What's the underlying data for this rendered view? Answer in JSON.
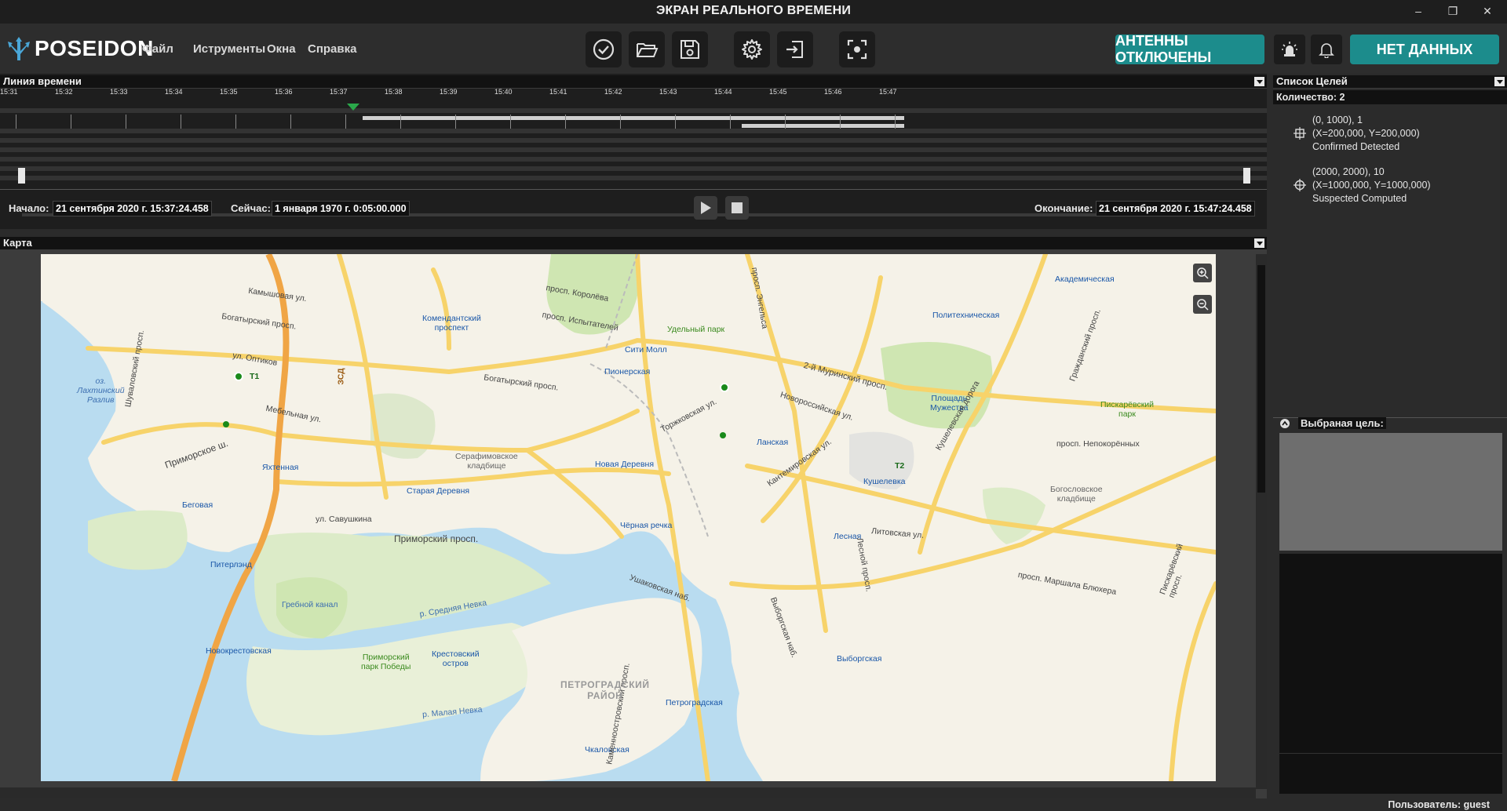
{
  "window": {
    "title": "ЭКРАН РЕАЛЬНОГО ВРЕМЕНИ"
  },
  "app": {
    "logo_text": "POSEIDON",
    "menu": [
      "Файл",
      "Иструменты",
      "Окна",
      "Справка"
    ],
    "antennas_button": "АНТЕННЫ ОТКЛЮЧЕНЫ",
    "data_button": "НЕТ ДАННЫХ",
    "toolbar_icons": [
      "check-circle-icon",
      "folder-open-icon",
      "save-icon",
      "gear-icon",
      "sign-in-icon",
      "focus-icon"
    ],
    "accent_color": "#1c8c8c"
  },
  "timeline": {
    "title": "Линия времени",
    "ticks": [
      "15:31",
      "15:32",
      "15:33",
      "15:34",
      "15:35",
      "15:36",
      "15:37",
      "15:38",
      "15:39",
      "15:40",
      "15:41",
      "15:42",
      "15:43",
      "15:44",
      "15:45",
      "15:46",
      "15:47"
    ],
    "start_label": "Начало:",
    "start_value": "21 сентября 2020 г. 15:37:24.458",
    "now_label": "Сейчас:",
    "now_value": "1 января 1970 г. 0:05:00.000",
    "end_label": "Окончание:",
    "end_value": "21 сентября 2020 г. 15:47:24.458"
  },
  "map": {
    "title": "Карта",
    "district": "ПЕТРОГРАДСКИЙ\nРАЙОН",
    "labels": [
      "Комендантский\nпроспект",
      "Удельный парк",
      "Сити Молл",
      "Пионерская",
      "Политехническая",
      "Академическая",
      "Площадь\nМужества",
      "Пискарёвский\nпарк",
      "Ланская",
      "Новая Деревня",
      "Серафимовское\nкладбище",
      "Старая Деревня",
      "Беговая",
      "Яхтенная",
      "Кушелевка",
      "Богословское\nкладбище",
      "Чёрная речка",
      "Лесная",
      "Выборгская",
      "Питерлэнд",
      "Новокрестовская",
      "Приморский\nпарк Победы",
      "Крестовский\nостров",
      "Петроградская",
      "Чкаловская",
      "оз.\nЛахтинский\nРазлив",
      "Богатырский просп.",
      "Приморский просп.",
      "Приморское ш.",
      "2-й Муринский просп.",
      "просп. Непокорённых",
      "Гребной канал",
      "р. Средняя Невка",
      "р. Малая Невка",
      "Ушаковская наб.",
      "Выборгская наб.",
      "просп. Энгельса",
      "Торжковская ул.",
      "просп. Маршала Блюхера",
      "Кушелевская дорога",
      "Гражданский просп.",
      "Пискарёвский просп.",
      "Лесной просп.",
      "ул. Савушкина",
      "Шуваловский просп.",
      "Камышовая ул.",
      "Богатырский просп.",
      "ул. Оптиков",
      "Мебельная ул.",
      "Каменноостровский просп.",
      "Литовская ул.",
      "просп. Королёва",
      "просп. Испытателей",
      "Новороссийская ул.",
      "Кантемировская ул.",
      "ЗСД",
      "Т1",
      "Т2"
    ]
  },
  "targets": {
    "title": "Список Целей",
    "count_label": "Количество: 2",
    "items": [
      {
        "line1": "(0, 1000), 1",
        "line2": "(X=200,000, Y=200,000)",
        "line3": "Confirmed Detected"
      },
      {
        "line1": "(2000, 2000), 10",
        "line2": "(X=1000,000, Y=1000,000)",
        "line3": "Suspected Computed"
      }
    ],
    "selected_label": "Выбраная цель:"
  },
  "status": {
    "user": "Пользователь: guest"
  }
}
